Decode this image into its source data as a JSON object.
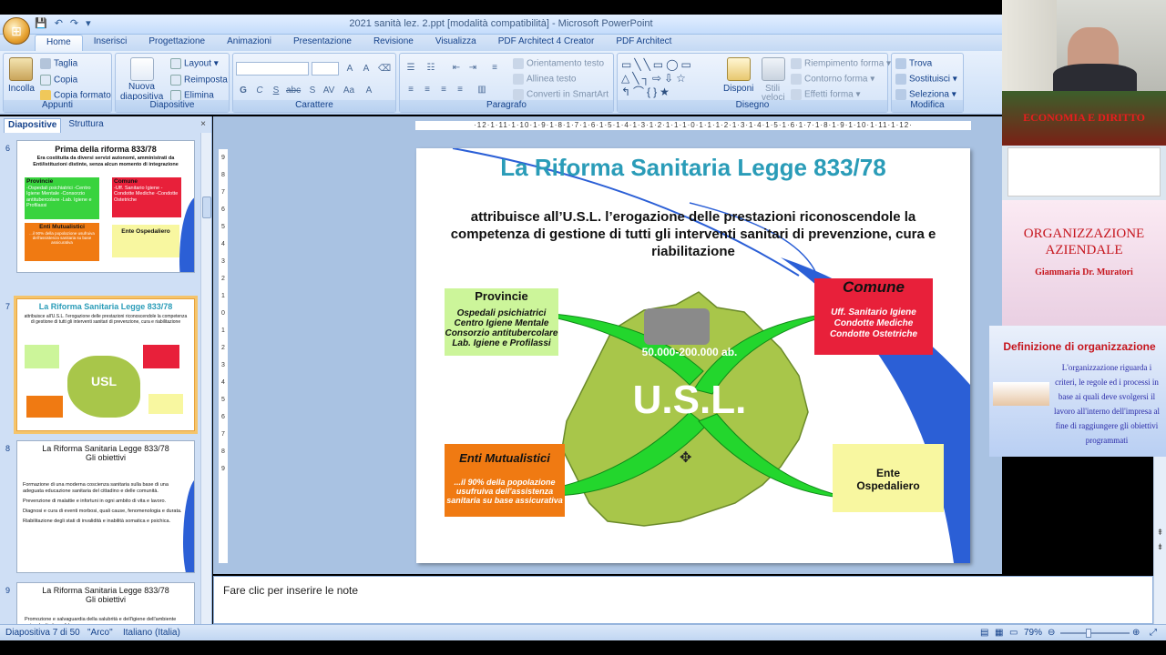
{
  "window": {
    "title": "2021 sanità lez. 2.ppt [modalità compatibilità] - Microsoft PowerPoint"
  },
  "ribbon_tabs": [
    "Home",
    "Inserisci",
    "Progettazione",
    "Animazioni",
    "Presentazione",
    "Revisione",
    "Visualizza",
    "PDF Architect 4 Creator",
    "PDF Architect"
  ],
  "ribbon": {
    "appunti": {
      "label": "Appunti",
      "incolla": "Incolla",
      "taglia": "Taglia",
      "copia": "Copia",
      "copia_formato": "Copia formato"
    },
    "diapositive": {
      "label": "Diapositive",
      "nuova": "Nuova",
      "diapositiva": "diapositiva",
      "layout": "Layout",
      "reimposta": "Reimposta",
      "elimina": "Elimina"
    },
    "carattere": {
      "label": "Carattere"
    },
    "paragrafo": {
      "label": "Paragrafo",
      "orientamento": "Orientamento testo",
      "allinea": "Allinea testo",
      "converti": "Converti in SmartArt"
    },
    "disegno": {
      "label": "Disegno",
      "disponi": "Disponi",
      "stili": "Stili",
      "veloci": "veloci",
      "riempimento": "Riempimento forma",
      "contorno": "Contorno forma",
      "effetti": "Effetti forma"
    },
    "modifica": {
      "label": "Modifica",
      "trova": "Trova",
      "sostituisci": "Sostituisci",
      "seleziona": "Seleziona"
    }
  },
  "side_panel": {
    "tab_diapositive": "Diapositive",
    "tab_struttura": "Struttura",
    "close": "×",
    "thumbs": [
      {
        "num": "6",
        "title": "Prima della riforma 833/78",
        "sub": "Era costituita da diversi servizi autonomi, amministrati da Enti/istituzioni distinte, senza alcun momento di integrazione",
        "b1": "Provincie",
        "b1_items": "-Ospedali psichiatrici -Centro Igiene Mentale -Consorzio antitubercolare -Lab. Igiene e Profilassi",
        "b2": "Comune",
        "b2_items": "-Uff. Sanitario Igiene -Condotte Mediche -Condotte Ostetriche",
        "b3": "Enti Mutualistici",
        "b3_items": "...il 90% della popolazione usufruiva dell'assistenza sanitaria su base assicurativa",
        "b4": "Ente Ospedaliero"
      },
      {
        "num": "7",
        "title": "La Riforma Sanitaria Legge 833/78",
        "sub": "attribuisce all'U.S.L. l'erogazione delle prestazioni riconoscendole la competenza di gestione di tutti gli interventi sanitari di prevenzione, cura e riabilitazione",
        "usl": "USL"
      },
      {
        "num": "8",
        "title": "La Riforma Sanitaria Legge 833/78",
        "title2": "Gli obiettivi",
        "items": [
          "Formazione di una moderna coscienza sanitaria sulla base di una adeguata educazione sanitaria del cittadino e delle comunità.",
          "Prevenzione di malattie e infortuni in ogni ambito di vita e lavoro.",
          "Diagnosi e cura di eventi morbosi, quali cause, fenomenologia e durata.",
          "Riabilitazione degli stati di invalidità e inabilità somatica e psichica."
        ]
      },
      {
        "num": "9",
        "title": "La Riforma Sanitaria Legge 833/78",
        "title2": "Gli obiettivi",
        "items": [
          "Promozione e salvaguardia della salubrità e dell'igiene dell'ambiente naturale di vita e di lavoro."
        ]
      }
    ]
  },
  "ruler_h": "·12·1·11·1·10·1·9·1·8·1·7·1·6·1·5·1·4·1·3·1·2·1·1·1·0·1·1·1·2·1·3·1·4·1·5·1·6·1·7·1·8·1·9·1·10·1·11·1·12·",
  "ruler_v": [
    "9",
    "8",
    "7",
    "6",
    "5",
    "4",
    "3",
    "2",
    "1",
    "0",
    "1",
    "2",
    "3",
    "4",
    "5",
    "6",
    "7",
    "8",
    "9"
  ],
  "slide": {
    "title": "La Riforma Sanitaria Legge 833/78",
    "body": "attribuisce all’U.S.L. l’erogazione delle prestazioni riconoscendole la competenza di gestione di tutti gli interventi sanitari di prevenzione, cura e riabilitazione",
    "provincie_title": "Provincie",
    "provincie_text": "Ospedali psichiatrici Centro Igiene Mentale Consorzio antitubercolare Lab. Igiene e Profilassi",
    "comune_title": "Comune",
    "comune_text": "Uff. Sanitario Igiene Condotte Mediche Condotte Ostetriche",
    "enti_title": "Enti Mutualistici",
    "enti_text": "...il 90% della popolazione usufruiva dell'assistenza sanitaria su base assicurativa",
    "ospedaliero_text": "Ente Ospedaliero",
    "population": "50.000-200.000 ab.",
    "usl": "U.S.L."
  },
  "notes_placeholder": "Fare clic per inserire le note",
  "status": {
    "slide": "Diapositiva 7 di 50",
    "theme": "\"Arco\"",
    "language": "Italiano (Italia)",
    "zoom": "79%"
  },
  "overlays": {
    "banner": "ECONOMIA E DIRITTO",
    "org_title": "ORGANIZZAZIONE AZIENDALE",
    "org_author": "Giammaria Dr. Muratori",
    "def_title": "Definizione di organizzazione",
    "def_text": "L'organizzazione riguarda i criteri, le regole ed i processi in base ai quali deve svolgersi il lavoro all'interno dell'impresa al fine di raggiungere gli obiettivi programmati"
  },
  "colors": {
    "accent": "#2a9cb8",
    "green_box": "#ccf59a",
    "red_box": "#e8203a",
    "orange_box": "#f07a12",
    "yellow_box": "#f8f7a0",
    "map_green": "#a8c64a",
    "arrow_green": "#23d62d",
    "slide_blue": "#2b5fd6"
  }
}
